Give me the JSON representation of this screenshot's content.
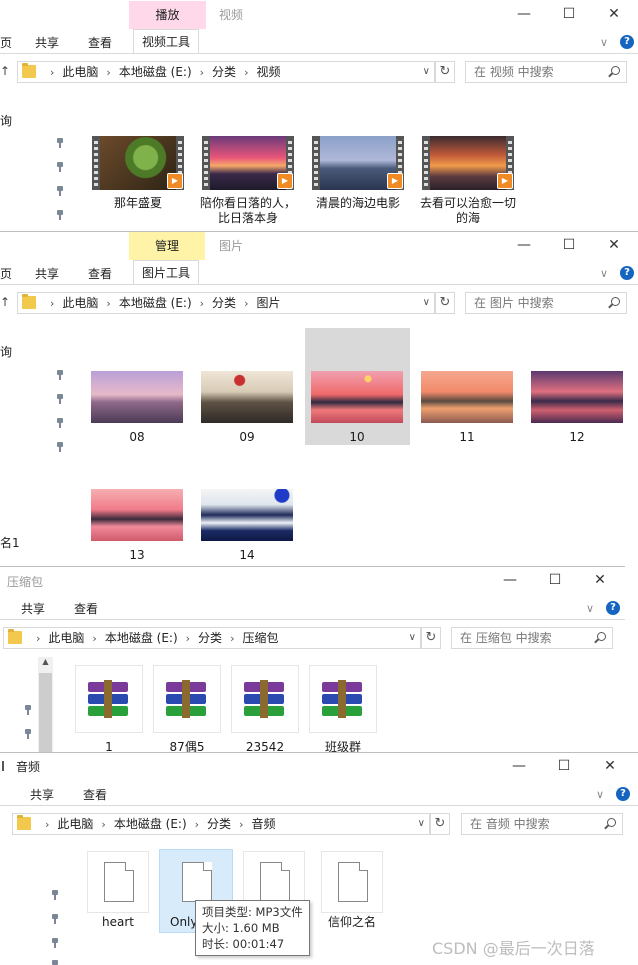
{
  "colors": {
    "accent_play": "#ffd9ea",
    "accent_manage": "#fff3a8",
    "help": "#1565c0"
  },
  "video_window": {
    "context_tab": "播放",
    "title": "视频",
    "tabs": {
      "share": "共享",
      "view": "查看",
      "tools": "视频工具",
      "partial": "页"
    },
    "crumbs": [
      "此电脑",
      "本地磁盘 (E:)",
      "分类",
      "视频"
    ],
    "search_placeholder": "在 视频 中搜索",
    "nav_partial": "询",
    "items": [
      {
        "label": "那年盛夏"
      },
      {
        "label": "陪你看日落的人，比日落本身"
      },
      {
        "label": "清晨的海边电影"
      },
      {
        "label": "去看可以治愈一切的海"
      }
    ]
  },
  "image_window": {
    "context_tab": "管理",
    "title": "图片",
    "tabs": {
      "share": "共享",
      "view": "查看",
      "tools": "图片工具",
      "partial": "页"
    },
    "crumbs": [
      "此电脑",
      "本地磁盘 (E:)",
      "分类",
      "图片"
    ],
    "search_placeholder": "在 图片 中搜索",
    "nav_partial": "询",
    "nav_partial2": "名1",
    "items": [
      {
        "label": "08"
      },
      {
        "label": "09"
      },
      {
        "label": "10"
      },
      {
        "label": "11"
      },
      {
        "label": "12"
      },
      {
        "label": "13"
      },
      {
        "label": "14"
      }
    ]
  },
  "archive_window": {
    "title": "压缩包",
    "tabs": {
      "share": "共享",
      "view": "查看"
    },
    "crumbs": [
      "此电脑",
      "本地磁盘 (E:)",
      "分类",
      "压缩包"
    ],
    "search_placeholder": "在 压缩包 中搜索",
    "items": [
      {
        "label": "1"
      },
      {
        "label": "87偶5"
      },
      {
        "label": "23542"
      },
      {
        "label": "班级群"
      }
    ]
  },
  "audio_window": {
    "title": "音频",
    "tabs": {
      "share": "共享",
      "view": "查看"
    },
    "crumbs": [
      "此电脑",
      "本地磁盘 (E:)",
      "分类",
      "音频"
    ],
    "search_placeholder": "在 音频 中搜索",
    "items": [
      {
        "label": "heart"
      },
      {
        "label": "Only"
      },
      {
        "label": ""
      },
      {
        "label": "信仰之名"
      }
    ],
    "tooltip": {
      "type": "项目类型: MP3文件",
      "size": "大小: 1.60 MB",
      "duration": "时长: 00:01:47"
    }
  },
  "caption_buttons": {
    "minimize": "—",
    "maximize": "☐",
    "close": "✕"
  },
  "watermark": "CSDN @最后一次日落"
}
